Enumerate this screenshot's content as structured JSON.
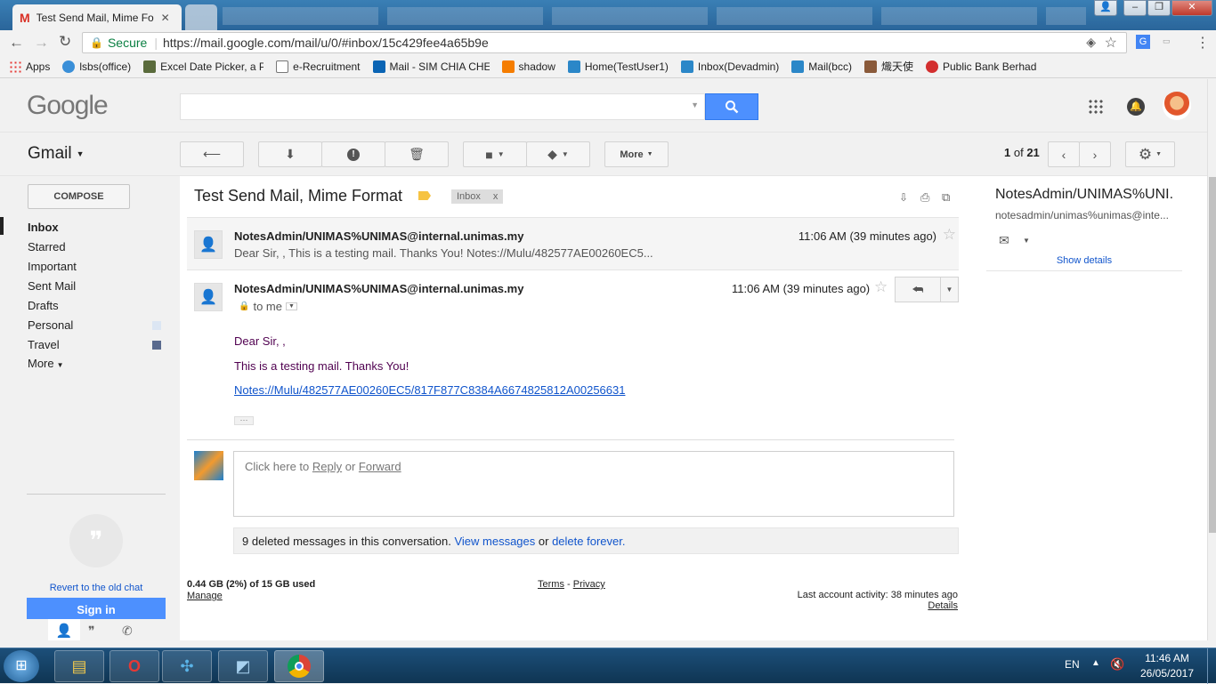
{
  "browser": {
    "tabs": [
      {
        "title": "Test Send Mail, Mime Fo"
      }
    ],
    "secure_label": "Secure",
    "url": "https://mail.google.com/mail/u/0/#inbox/15c429fee4a65b9e",
    "bookmarks": [
      "Apps",
      "lsbs(office)",
      "Excel Date Picker, a Po",
      "e-Recruitment",
      "Mail - SIM CHIA CHE",
      "shadow",
      "Home(TestUser1)",
      "Inbox(Devadmin)",
      "Mail(bcc)",
      "熾天使",
      "Public Bank Berhad"
    ]
  },
  "gmail": {
    "logo": "Google",
    "app_label": "Gmail",
    "toolbar": {
      "more_label": "More",
      "pager_current": "1",
      "pager_of": "of",
      "pager_total": "21"
    },
    "nav": {
      "compose": "COMPOSE",
      "items": [
        "Inbox",
        "Starred",
        "Important",
        "Sent Mail",
        "Drafts",
        "Personal",
        "Travel",
        "More"
      ]
    },
    "thread": {
      "subject": "Test Send Mail, Mime Format",
      "label": "Inbox",
      "label_close": "x",
      "msg1": {
        "sender": "NotesAdmin/UNIMAS%UNIMAS@internal.unimas.my",
        "time": "11:06 AM (39 minutes ago)",
        "snippet": "Dear Sir, , This is a testing mail. Thanks You! Notes://Mulu/482577AE00260EC5..."
      },
      "msg2": {
        "sender": "NotesAdmin/UNIMAS%UNIMAS@internal.unimas.my",
        "time": "11:06 AM (39 minutes ago)",
        "to": "to me",
        "line1": "Dear Sir, ,",
        "line2": "This is a testing mail. Thanks You!",
        "link": "Notes://Mulu/482577AE00260EC5/817F877C8384A6674825812A00256631",
        "ellipsis": "···"
      },
      "reply": {
        "prefix": "Click here to ",
        "reply": "Reply",
        "or": " or ",
        "forward": "Forward"
      },
      "deleted": {
        "text": "9 deleted messages in this conversation. ",
        "view": "View messages",
        "or": " or ",
        "delete": "delete forever."
      }
    },
    "footer": {
      "storage": "0.44 GB (2%) of 15 GB used",
      "manage": "Manage",
      "terms": "Terms",
      "dash": " - ",
      "privacy": "Privacy",
      "activity": "Last account activity: 38 minutes ago",
      "details": "Details"
    },
    "chat": {
      "revert": "Revert to the old chat",
      "signin": "Sign in"
    },
    "contact": {
      "name": "NotesAdmin/UNIMAS%UNI.",
      "email": "notesadmin/unimas%unimas@inte...",
      "show_details": "Show details"
    }
  },
  "taskbar": {
    "lang": "EN",
    "time": "11:46 AM",
    "date": "26/05/2017"
  },
  "colors": {
    "accent": "#4d90fe",
    "link": "#1155cc",
    "body_text": "#500050"
  }
}
